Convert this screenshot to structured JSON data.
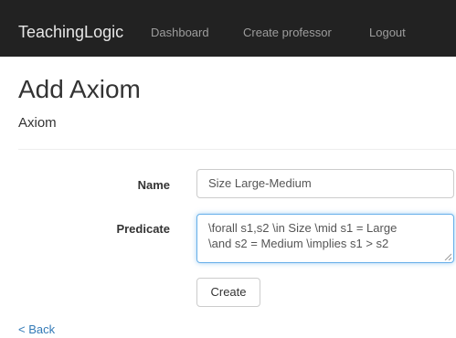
{
  "navbar": {
    "brand": "TeachingLogic",
    "links": [
      "Dashboard",
      "Create professor",
      "Logout"
    ]
  },
  "page": {
    "title": "Add Axiom",
    "subtitle": "Axiom"
  },
  "form": {
    "name_label": "Name",
    "name_value": "Size Large-Medium",
    "predicate_label": "Predicate",
    "predicate_line1": "\\forall s1,s2 \\in Size \\mid s1 = Large",
    "predicate_line2": "\\and s2 = Medium \\implies s1 > s2",
    "submit_label": "Create"
  },
  "footer": {
    "back_label": "< Back"
  },
  "colors": {
    "navbar_bg": "#222222",
    "link": "#337ab7",
    "focus": "#66afe9"
  }
}
